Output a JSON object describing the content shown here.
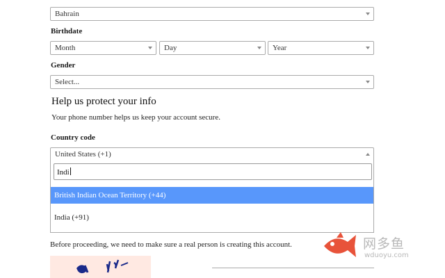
{
  "country_of_residence": {
    "value": "Bahrain"
  },
  "birthdate": {
    "label": "Birthdate",
    "month": "Month",
    "day": "Day",
    "year": "Year"
  },
  "gender": {
    "label": "Gender",
    "value": "Select..."
  },
  "protect": {
    "heading": "Help us protect your info",
    "text": "Your phone number helps us keep your account secure."
  },
  "country_code": {
    "label": "Country code",
    "value": "United States (+1)",
    "search_value": "Indi",
    "options": [
      {
        "label": "British Indian Ocean Territory (+44)",
        "highlighted": true
      },
      {
        "label": "India (+91)",
        "highlighted": false
      }
    ]
  },
  "verification": {
    "text": "Before proceeding, we need to make sure a real person is creating this account."
  },
  "watermark": {
    "brand": "网多鱼",
    "url": "wduoyu.com"
  },
  "colors": {
    "highlight": "#5897fb",
    "watermark": "#e8533a"
  }
}
